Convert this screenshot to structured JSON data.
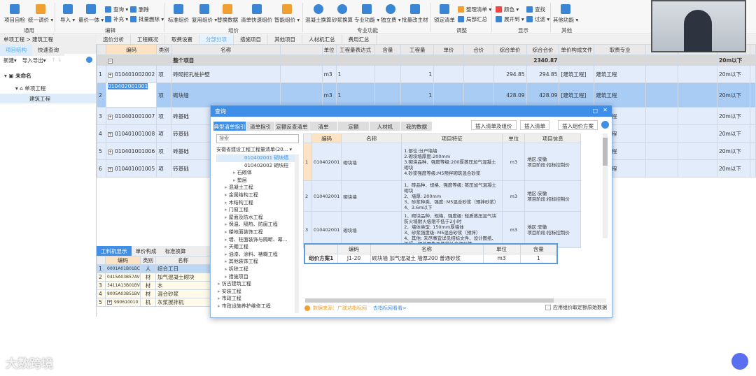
{
  "ribbon": {
    "groups": [
      {
        "label": "通用"
      },
      {
        "label": "编辑"
      },
      {
        "label": "组价"
      },
      {
        "label": "专业功能"
      },
      {
        "label": "调整"
      },
      {
        "label": "显示"
      },
      {
        "label": "其他"
      }
    ],
    "big_buttons": [
      "项目自检",
      "统一调价 ▾",
      "导入 ▾",
      "量价一体 ▾",
      "标准组价",
      "复用组价 ▾",
      "替换数据",
      "清单快速组价",
      "智能组价 ▾",
      "混凝土换算",
      "砂浆换算",
      "专业功能 ▾",
      "独立费 ▾",
      "批量改主材",
      "锁定清单",
      "其他功能 ▾"
    ],
    "small_buttons": [
      "查询 ▾",
      "删除",
      "补充 ▾",
      "批量删除 ▾",
      "整理清单 ▾",
      "局部汇总",
      "颜色 ▾",
      "查找",
      "展开到 ▾",
      "过滤 ▾"
    ]
  },
  "breadcrumb": "单项工程 > 建筑工程",
  "main_tabs": [
    "造价分析",
    "工程概况",
    "取费设置",
    "分部分项",
    "措施项目",
    "其他项目",
    "人材机汇总",
    "费用汇总"
  ],
  "active_main_tab": "分部分项",
  "left": {
    "tabs": [
      "项目结构",
      "快速查询"
    ],
    "toolbar": [
      "新建▾",
      "导入导出▾"
    ],
    "tree": [
      "未命名",
      "单项工程",
      "建筑工程"
    ]
  },
  "grid": {
    "headers": [
      "",
      "编码",
      "类别",
      "名称",
      "",
      "单位",
      "工程量表达式",
      "含量",
      "工程量",
      "单价",
      "合价",
      "综合单价",
      "综合合价",
      "单价构成文件",
      "取费专业",
      "",
      "",
      "",
      ""
    ],
    "summary": {
      "label": "整个项目",
      "total": "2340.87",
      "height": "20m以下"
    },
    "rows": [
      {
        "n": "1",
        "code": "010401002002",
        "type": "项",
        "name": "砖砌挖孔桩护壁",
        "unit": "m3",
        "expr": "1",
        "qty": "1",
        "unit_price": "294.85",
        "total": "294.85",
        "file": "[建筑工程]",
        "spec": "建筑工程",
        "height": "20m以下"
      },
      {
        "n": "2",
        "code": "010402001001",
        "type": "项",
        "name": "砌块墙",
        "unit": "m3",
        "expr": "1",
        "qty": "1",
        "unit_price": "428.09",
        "total": "428.09",
        "file": "[建筑工程]",
        "spec": "建筑工程",
        "height": "20m以下"
      },
      {
        "n": "3",
        "code": "010401001007",
        "type": "项",
        "name": "砖基础",
        "spec": "建筑工程",
        "height": "20m以下"
      },
      {
        "n": "4",
        "code": "010401001008",
        "type": "项",
        "name": "砖基础",
        "spec": "建筑工程",
        "height": "20m以下"
      },
      {
        "n": "5",
        "code": "010401001006",
        "type": "项",
        "name": "砖基础",
        "spec": "建筑工程",
        "height": "20m以下"
      },
      {
        "n": "6",
        "code": "010401001005",
        "type": "项",
        "name": "砖基础",
        "spec": "建筑工程",
        "height": "20m以下"
      }
    ]
  },
  "bottom": {
    "tabs": [
      "工料机显示",
      "单价构成",
      "标准换算"
    ],
    "headers": [
      "",
      "编码",
      "类别",
      "名称"
    ],
    "rows": [
      {
        "n": "1",
        "code": "0001A01B01BC",
        "type": "人",
        "name": "综合工日"
      },
      {
        "n": "2",
        "code": "0415A03B57AV",
        "type": "材",
        "name": "加气混凝土砌块"
      },
      {
        "n": "3",
        "code": "3411A13B01BV",
        "type": "材",
        "name": "水"
      },
      {
        "n": "4",
        "code": "8005A03B51BV",
        "type": "材",
        "name": "混合砂浆"
      },
      {
        "n": "5",
        "code": "990610010",
        "type": "机",
        "name": "灰浆搅拌机"
      }
    ]
  },
  "dialog": {
    "title": "查询",
    "tabs": [
      "典型清单指引",
      "清单指引",
      "定额反查清单",
      "清单",
      "定额",
      "人材机",
      "我的数据"
    ],
    "buttons": [
      "插入清单及组价",
      "插入清单",
      "插入组价方案"
    ],
    "search_placeholder": "搜索",
    "library": "安徽省建设工程工程量清单(20...",
    "tree": [
      "010402001 砌块墙",
      "010402002 砌块柱",
      "石砌体",
      "垫层",
      "混凝土工程",
      "金属结构工程",
      "木结构工程",
      "门窗工程",
      "屋面及防水工程",
      "保温、隔热、防腐工程",
      "楼地面装饰工程",
      "墙、柱面装饰与隔断、幕...",
      "天棚工程",
      "油漆、涂料、裱糊工程",
      "其他装饰工程",
      "拆除工程",
      "措施项目",
      "仿古建筑工程",
      "安装工程",
      "市政工程",
      "市政设施养护维修工程"
    ],
    "grid_headers": [
      "",
      "编码",
      "名称",
      "项目特征",
      "单位",
      "项目信息"
    ],
    "rows": [
      {
        "n": "1",
        "code": "010402001",
        "name": "砌块墙",
        "feature": "1.部位:分户墙墙\n2.砌块墙厚度:200mm\n3.砌块品种、强度等级:200厚蒸压加气混凝土砌块\n4.砂浆强度等级:M5预拌砌筑混合砂浆",
        "unit": "m3",
        "info": "地区:安徽\n项目阶段:招标控制价"
      },
      {
        "n": "2",
        "code": "010402001",
        "name": "砌块墙",
        "feature": "1、砖品种、规格、强度等级: 蒸压加气混凝土砌块\n2、墙厚: 200mm\n3、砂浆种类、强度: M5混合砂浆（预拌砂浆）\n4、3.6m以下",
        "unit": "m3",
        "info": "地区:安徽\n项目阶段:招标控制价"
      },
      {
        "n": "3",
        "code": "010402001",
        "name": "砌块墙",
        "feature": "1、砌块品种、规格、强度级: 轻质蒸压加气块 防火墙耐火极限不低于2小时\n2、墙体类型: 150mm厚墙体\n3、砂浆强度级: M5混合砂浆（预拌）\n4、其他: 未尽事宜详见招标文件、设计图纸、答疑、相关图集及其他补充资料等",
        "unit": "m3",
        "info": "地区:安徽\n项目阶段:招标控制价"
      }
    ],
    "plan_headers": [
      "",
      "编码",
      "名称",
      "单位",
      "含量"
    ],
    "plan": {
      "label": "组价方案1",
      "code": "J1-20",
      "name": "砌块墙 加气混凝土 墙厚200 普通砂浆",
      "unit": "m3",
      "qty": "1"
    },
    "source": "数据来源：广联达指标网",
    "link": "去指标网看看>",
    "checkbox": "应用组价取定额原始数据"
  },
  "watermark": "大数跨境",
  "colors": {
    "accent": "#3d8fe8",
    "selected_row": "#a9ccf5",
    "row": "#e3ecfb",
    "header_code": "#fce3c4"
  }
}
